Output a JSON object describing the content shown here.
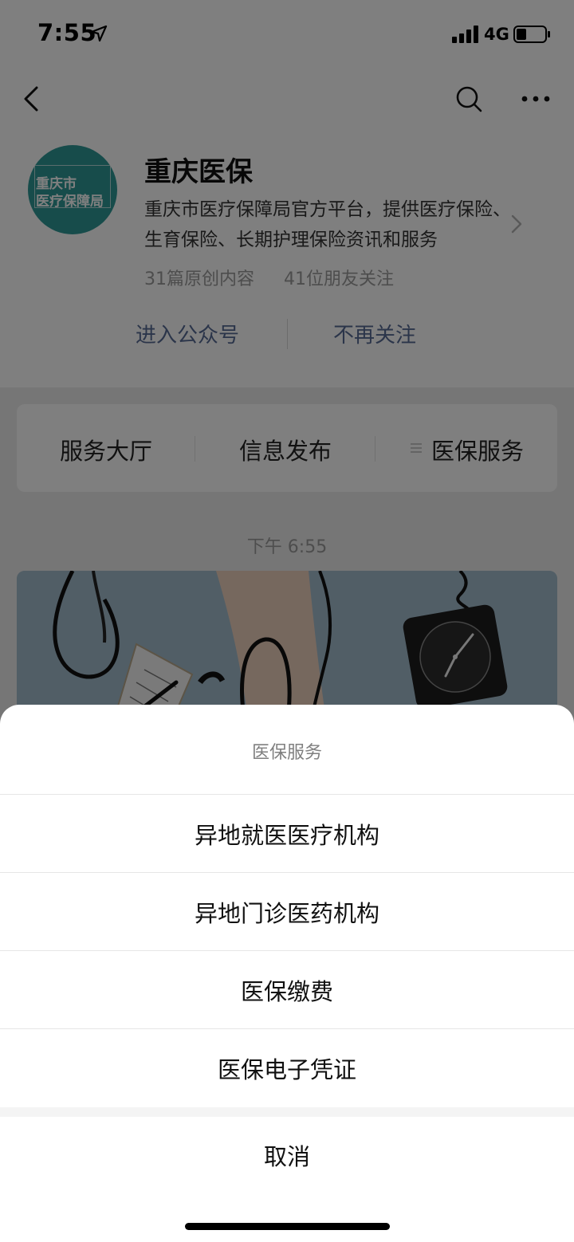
{
  "status_bar": {
    "time": "7:55",
    "network": "4G",
    "icons": [
      "location-arrow-icon",
      "signal-bars-icon",
      "battery-icon"
    ]
  },
  "nav": {
    "icons": [
      "chevron-left-icon",
      "search-icon",
      "more-dots-icon"
    ]
  },
  "account": {
    "avatar_line1": "重庆市",
    "avatar_line2": "医疗保障局",
    "name": "重庆医保",
    "description": "重庆市医疗保障局官方平台，提供医疗保险、生育保险、长期护理保险资讯和服务",
    "original_count": "31篇原创内容",
    "friends_following": "41位朋友关注",
    "enter_label": "进入公众号",
    "unfollow_label": "不再关注"
  },
  "menu": {
    "items": [
      {
        "label": "服务大厅"
      },
      {
        "label": "信息发布"
      },
      {
        "label": "医保服务"
      }
    ]
  },
  "feed": {
    "timestamp": "下午 6:55"
  },
  "sheet": {
    "title": "医保服务",
    "options": [
      {
        "label": "异地就医医疗机构"
      },
      {
        "label": "异地门诊医药机构"
      },
      {
        "label": "医保缴费"
      },
      {
        "label": "医保电子凭证"
      }
    ],
    "cancel_label": "取消"
  },
  "colors": {
    "link": "#576b95",
    "avatar": "#2f9896",
    "overlay": "rgba(0,0,0,0.5)"
  }
}
